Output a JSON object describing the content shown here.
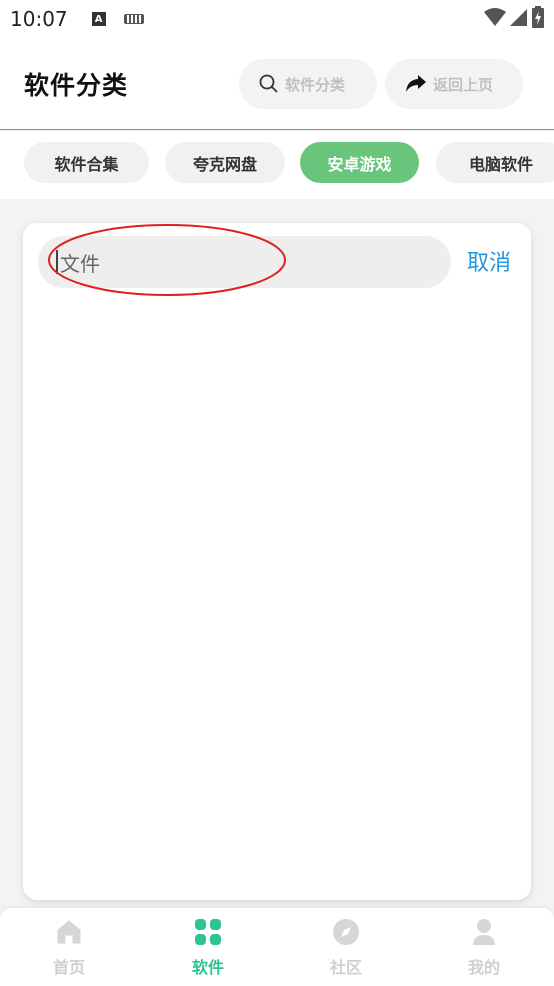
{
  "status_bar": {
    "time": "10:07",
    "icons": [
      "a-notification-icon",
      "keyboard-icon",
      "wifi-icon",
      "signal-icon",
      "battery-icon"
    ]
  },
  "header": {
    "title": "软件分类",
    "search_label": "软件分类",
    "back_label": "返回上页"
  },
  "tabs": [
    {
      "label": "软件合集",
      "active": false
    },
    {
      "label": "夸克网盘",
      "active": false
    },
    {
      "label": "安卓游戏",
      "active": true
    },
    {
      "label": "电脑软件",
      "active": false
    }
  ],
  "search": {
    "value": "文件",
    "cancel_label": "取消"
  },
  "bottom_nav": [
    {
      "label": "首页",
      "icon": "home-icon",
      "active": false
    },
    {
      "label": "软件",
      "icon": "apps-grid-icon",
      "active": true
    },
    {
      "label": "社区",
      "icon": "compass-icon",
      "active": false
    },
    {
      "label": "我的",
      "icon": "user-icon",
      "active": false
    }
  ],
  "colors": {
    "accent_green": "#6ac57c",
    "nav_active": "#2ec48e",
    "link_blue": "#2196d8",
    "annotation_red": "#e02020"
  }
}
